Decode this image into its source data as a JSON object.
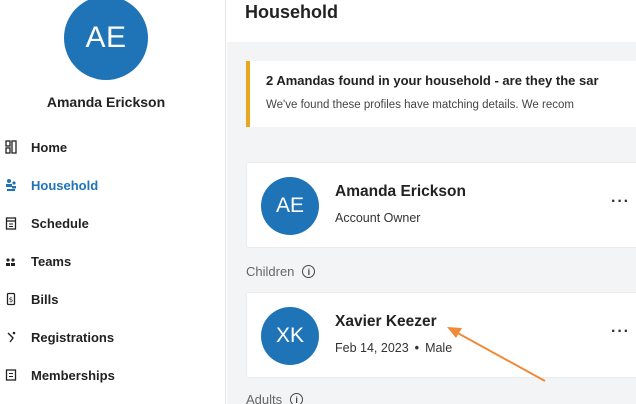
{
  "sidebar": {
    "profile": {
      "initials": "AE",
      "name": "Amanda Erickson"
    },
    "items": [
      {
        "label": "Home",
        "icon": "home-icon",
        "active": false
      },
      {
        "label": "Household",
        "icon": "household-icon",
        "active": true
      },
      {
        "label": "Schedule",
        "icon": "schedule-icon",
        "active": false
      },
      {
        "label": "Teams",
        "icon": "teams-icon",
        "active": false
      },
      {
        "label": "Bills",
        "icon": "bills-icon",
        "active": false
      },
      {
        "label": "Registrations",
        "icon": "registrations-icon",
        "active": false
      },
      {
        "label": "Memberships",
        "icon": "memberships-icon",
        "active": false
      }
    ]
  },
  "main": {
    "title": "Household",
    "alert": {
      "title": "2 Amandas found in your household - are they the sar",
      "body": "We've found these profiles have matching details. We recom"
    },
    "owner": {
      "initials": "AE",
      "name": "Amanda Erickson",
      "role": "Account Owner",
      "menu": "···"
    },
    "children_label": "Children",
    "child": {
      "initials": "XK",
      "name": "Xavier Keezer",
      "dob": "Feb 14, 2023",
      "separator": "•",
      "gender": "Male",
      "menu": "···"
    },
    "adults_label": "Adults"
  },
  "colors": {
    "accent": "#1f74b8",
    "warning": "#e9a621",
    "annotation_arrow": "#f08a3a"
  }
}
